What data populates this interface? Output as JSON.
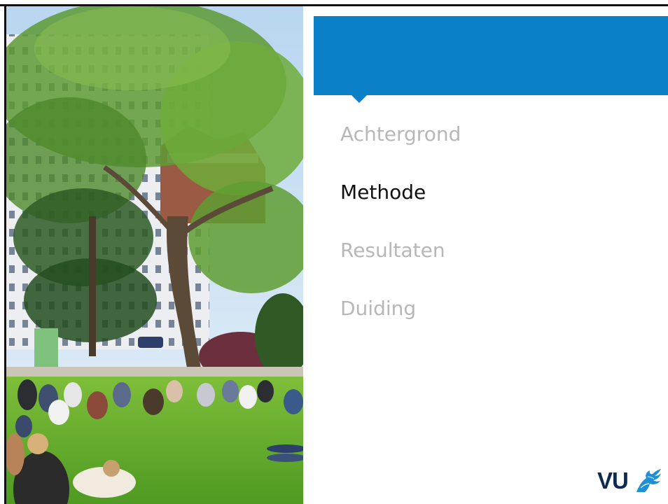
{
  "agenda": {
    "items": [
      {
        "label": "Achtergrond",
        "active": false
      },
      {
        "label": "Methode",
        "active": true
      },
      {
        "label": "Resultaten",
        "active": false
      },
      {
        "label": "Duiding",
        "active": false
      }
    ]
  },
  "logo": {
    "text": "VU",
    "icon": "griffin-icon"
  },
  "colors": {
    "accent": "#0b80c9",
    "inactive_text": "#b7b7b7",
    "active_text": "#111111",
    "logo": "#0e2a52"
  }
}
